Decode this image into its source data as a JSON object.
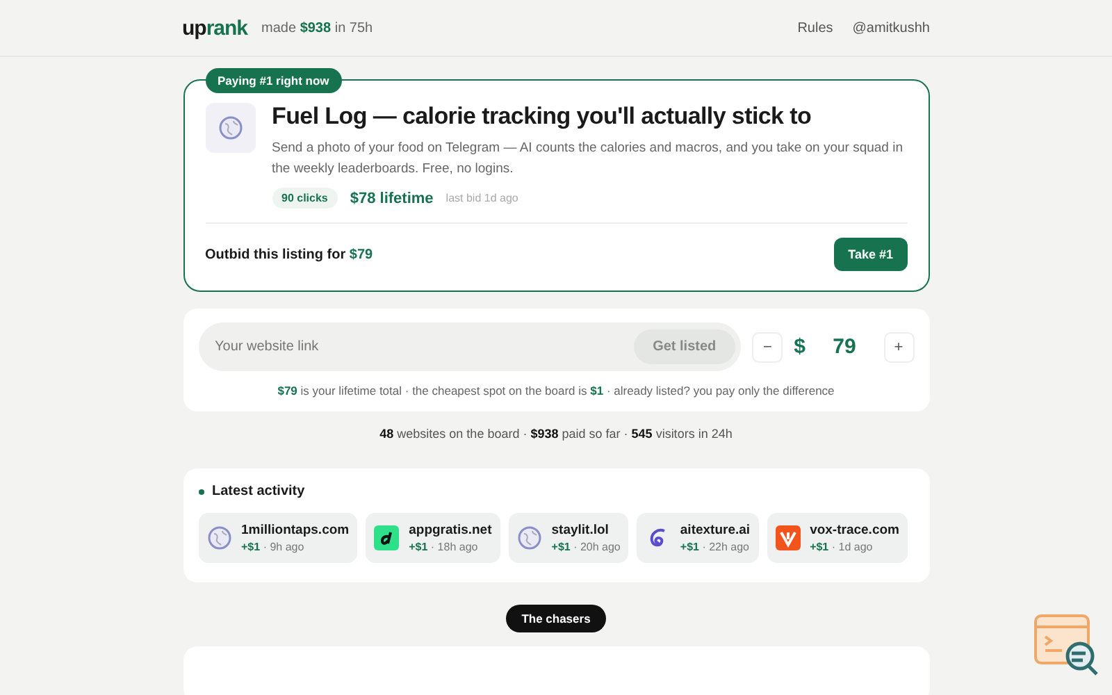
{
  "header": {
    "logo": {
      "part_1": "up",
      "part_2": "rank"
    },
    "earnings": "made **$938** in 75h",
    "nav": [
      "Rules",
      "@amitkushh"
    ]
  },
  "featured": {
    "badge": "Paying #1 right now",
    "title": "Fuel Log — calorie tracking you'll actually stick to",
    "description": "Send a photo of your food on Telegram — AI counts the calories and macros, and you take on your squad in the weekly leaderboards. Free, no logins.",
    "clicks": "90 clicks",
    "lifetime": "$78 lifetime",
    "last_bid": "last bid 1d ago",
    "outbid": "Outbid this listing for **$79**",
    "button": "Take #1"
  },
  "bid": {
    "placeholder": "Your website link",
    "button": "Get listed",
    "minus": "−",
    "currency": "$",
    "amount": "79",
    "plus": "+",
    "note": "**$79** is your lifetime total · the cheapest spot on the board is **$1** · already listed? you pay only the difference"
  },
  "stats": "**48** websites on the board · **$938** paid so far · **545** visitors in 24h",
  "activity": {
    "title": "Latest activity",
    "items": [
      {
        "site": "1milliontaps.com",
        "amount": "+$1",
        "time": "· 9h ago",
        "kind": "globe"
      },
      {
        "site": "appgratis.net",
        "amount": "+$1",
        "time": "· 18h ago",
        "kind": "letter"
      },
      {
        "site": "staylit.lol",
        "amount": "+$1",
        "time": "· 20h ago",
        "kind": "globe"
      },
      {
        "site": "aitexture.ai",
        "amount": "+$1",
        "time": "· 22h ago",
        "kind": "swirl"
      },
      {
        "site": "vox-trace.com",
        "amount": "+$1",
        "time": "· 1d ago",
        "kind": "vmark"
      }
    ]
  },
  "chasers": {
    "label": "The chasers"
  }
}
